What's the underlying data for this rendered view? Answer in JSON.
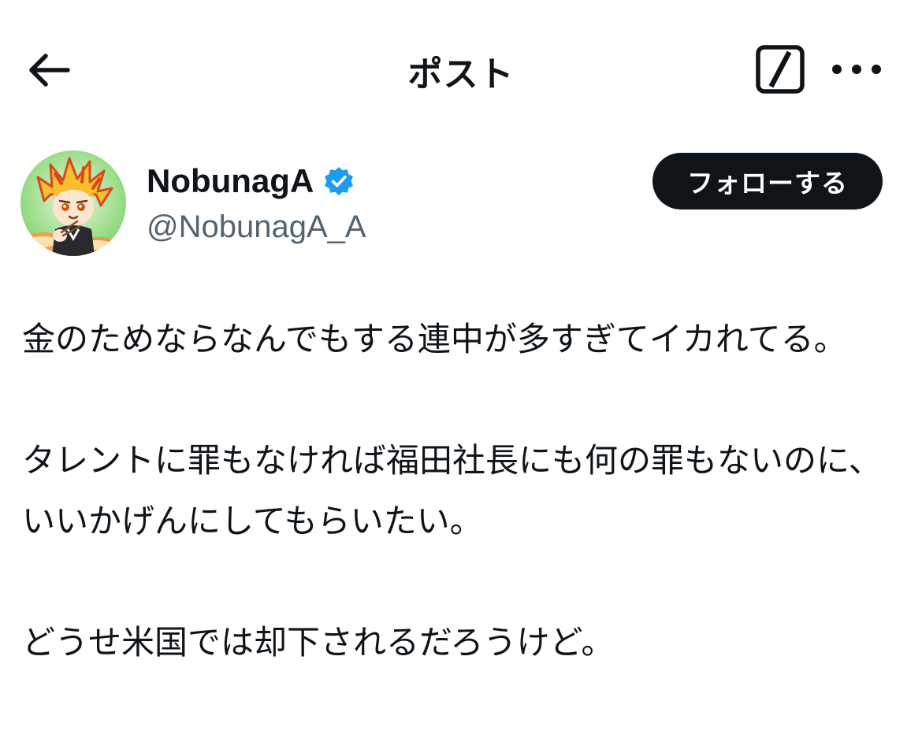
{
  "header": {
    "title": "ポスト",
    "back_icon": "arrow-left-icon",
    "grok_icon": "grok-icon",
    "more_icon": "more-horizontal-icon"
  },
  "author": {
    "display_name": "NobunagA",
    "handle": "@NobunagA_A",
    "verified": true,
    "verified_color": "#1d9bf0",
    "follow_label": "フォローする"
  },
  "post": {
    "paragraphs": [
      "金のためならなんでもする連中が多すぎてイカれてる。",
      "タレントに罪もなければ福田社長にも何の罪もないのに、いいかげんにしてもらいたい。",
      "どうせ米国では却下されるだろうけど。"
    ]
  },
  "colors": {
    "text": "#0f1419",
    "secondary_text": "#536471",
    "follow_bg": "#0f1419",
    "background": "#ffffff"
  }
}
